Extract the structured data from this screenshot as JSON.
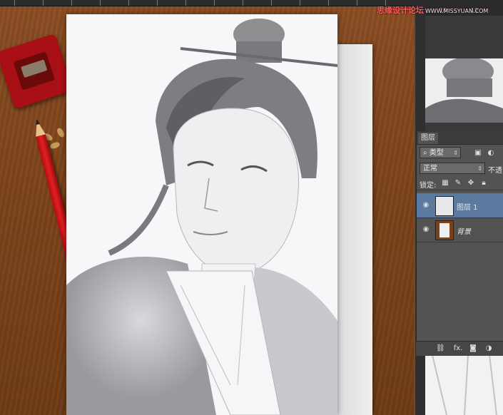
{
  "watermark": {
    "text": "思缘设计论坛",
    "url": "WWW.MISSYUAN.COM"
  },
  "ruler": {
    "marks": [
      "10",
      "12"
    ]
  },
  "layers_panel": {
    "tab": "图层",
    "filter": {
      "label": "类型",
      "icon": "search-icon"
    },
    "blend_mode": "正常",
    "opacity_label": "不透",
    "lock_label": "锁定:",
    "layers": [
      {
        "name": "图层 1",
        "selected": true,
        "kind": "sketch"
      },
      {
        "name": "背景",
        "selected": false,
        "kind": "background"
      }
    ],
    "bottom_icons": [
      "link-icon",
      "fx-icon",
      "mask-icon",
      "adjustment-icon"
    ],
    "fx_label": "fx."
  },
  "colors": {
    "wood": "#7a4219",
    "panel": "#535353",
    "selected_layer": "#5c7aa0",
    "pencil": "#e02024"
  }
}
